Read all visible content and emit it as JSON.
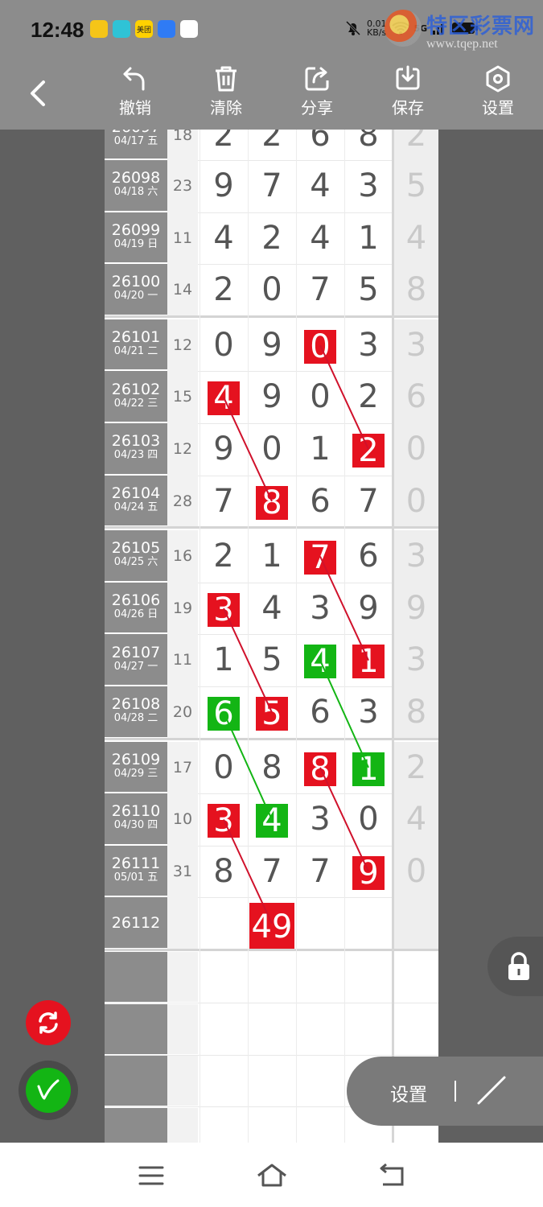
{
  "status_bar": {
    "time": "12:48",
    "app_icons": [
      {
        "icon": "coin-app-icon",
        "text": "",
        "color": "#f5c518"
      },
      {
        "icon": "video-app-icon",
        "text": "",
        "color": "#2fc3d6"
      },
      {
        "icon": "meituan-app-icon",
        "text": "美团",
        "color": "#ffd100"
      },
      {
        "icon": "payment-app-icon",
        "text": "",
        "color": "#2f7bf5"
      },
      {
        "icon": "calendar-app-icon",
        "text": "",
        "color": "#ffffff"
      }
    ],
    "netspeed_value": "0.01",
    "netspeed_unit": "KB/s",
    "signal_label": "5G"
  },
  "watermark": {
    "text": "特区彩票网",
    "url": "www.tqep.net"
  },
  "toolbar": {
    "undo_label": "撤销",
    "clear_label": "清除",
    "share_label": "分享",
    "save_label": "保存",
    "settings_label": "设置"
  },
  "table": {
    "rows": [
      {
        "period": "26097",
        "date": "04/17 五",
        "sum": "18",
        "digits": [
          "2",
          "2",
          "6",
          "8"
        ],
        "tail": "2",
        "hl": [
          null,
          null,
          null,
          null
        ],
        "partial": true
      },
      {
        "period": "26098",
        "date": "04/18 六",
        "sum": "23",
        "digits": [
          "9",
          "7",
          "4",
          "3"
        ],
        "tail": "5",
        "hl": [
          null,
          null,
          null,
          null
        ]
      },
      {
        "period": "26099",
        "date": "04/19 日",
        "sum": "11",
        "digits": [
          "4",
          "2",
          "4",
          "1"
        ],
        "tail": "4",
        "hl": [
          null,
          null,
          null,
          null
        ]
      },
      {
        "period": "26100",
        "date": "04/20 一",
        "sum": "14",
        "digits": [
          "2",
          "0",
          "7",
          "5"
        ],
        "tail": "8",
        "hl": [
          null,
          null,
          null,
          null
        ]
      },
      {
        "period": "26101",
        "date": "04/21 二",
        "sum": "12",
        "digits": [
          "0",
          "9",
          "0",
          "3"
        ],
        "tail": "3",
        "hl": [
          null,
          null,
          "red",
          null
        ]
      },
      {
        "period": "26102",
        "date": "04/22 三",
        "sum": "15",
        "digits": [
          "4",
          "9",
          "0",
          "2"
        ],
        "tail": "6",
        "hl": [
          "red",
          null,
          null,
          null
        ]
      },
      {
        "period": "26103",
        "date": "04/23 四",
        "sum": "12",
        "digits": [
          "9",
          "0",
          "1",
          "2"
        ],
        "tail": "0",
        "hl": [
          null,
          null,
          null,
          "red"
        ]
      },
      {
        "period": "26104",
        "date": "04/24 五",
        "sum": "28",
        "digits": [
          "7",
          "8",
          "6",
          "7"
        ],
        "tail": "0",
        "hl": [
          null,
          "red",
          null,
          null
        ]
      },
      {
        "period": "26105",
        "date": "04/25 六",
        "sum": "16",
        "digits": [
          "2",
          "1",
          "7",
          "6"
        ],
        "tail": "3",
        "hl": [
          null,
          null,
          "red",
          null
        ]
      },
      {
        "period": "26106",
        "date": "04/26 日",
        "sum": "19",
        "digits": [
          "3",
          "4",
          "3",
          "9"
        ],
        "tail": "9",
        "hl": [
          "red",
          null,
          null,
          null
        ]
      },
      {
        "period": "26107",
        "date": "04/27 一",
        "sum": "11",
        "digits": [
          "1",
          "5",
          "4",
          "1"
        ],
        "tail": "3",
        "hl": [
          null,
          null,
          "green",
          "red"
        ]
      },
      {
        "period": "26108",
        "date": "04/28 二",
        "sum": "20",
        "digits": [
          "6",
          "5",
          "6",
          "3"
        ],
        "tail": "8",
        "hl": [
          "green",
          "red",
          null,
          null
        ]
      },
      {
        "period": "26109",
        "date": "04/29 三",
        "sum": "17",
        "digits": [
          "0",
          "8",
          "8",
          "1"
        ],
        "tail": "2",
        "hl": [
          null,
          null,
          "red",
          "green"
        ]
      },
      {
        "period": "26110",
        "date": "04/30 四",
        "sum": "10",
        "digits": [
          "3",
          "4",
          "3",
          "0"
        ],
        "tail": "4",
        "hl": [
          "red",
          "green",
          null,
          null
        ]
      },
      {
        "period": "26111",
        "date": "05/01 五",
        "sum": "31",
        "digits": [
          "8",
          "7",
          "7",
          "9"
        ],
        "tail": "0",
        "hl": [
          null,
          null,
          null,
          "red"
        ]
      },
      {
        "period": "26112",
        "date": "",
        "sum": "",
        "digits": [
          "",
          "49",
          "",
          ""
        ],
        "tail": "",
        "hl": [
          null,
          "red-big",
          null,
          null
        ]
      }
    ],
    "empty_rows": 4,
    "link_color_red": "#d0112b",
    "link_color_green": "#13b514",
    "links": [
      {
        "from": [
          4,
          2
        ],
        "to": [
          6,
          3
        ],
        "color": "red"
      },
      {
        "from": [
          5,
          0
        ],
        "to": [
          7,
          1
        ],
        "color": "red"
      },
      {
        "from": [
          8,
          2
        ],
        "to": [
          10,
          3
        ],
        "color": "red"
      },
      {
        "from": [
          9,
          0
        ],
        "to": [
          11,
          1
        ],
        "color": "red"
      },
      {
        "from": [
          10,
          2
        ],
        "to": [
          12,
          3
        ],
        "color": "green"
      },
      {
        "from": [
          11,
          0
        ],
        "to": [
          13,
          1
        ],
        "color": "green"
      },
      {
        "from": [
          12,
          2
        ],
        "to": [
          14,
          3
        ],
        "color": "red"
      },
      {
        "from": [
          13,
          0
        ],
        "to": [
          15,
          1
        ],
        "color": "red"
      }
    ]
  },
  "floating": {
    "settings_label": "设置"
  },
  "colors": {
    "red": "#e5121f",
    "green": "#13b514",
    "toolbar": "#8c8c8c"
  }
}
